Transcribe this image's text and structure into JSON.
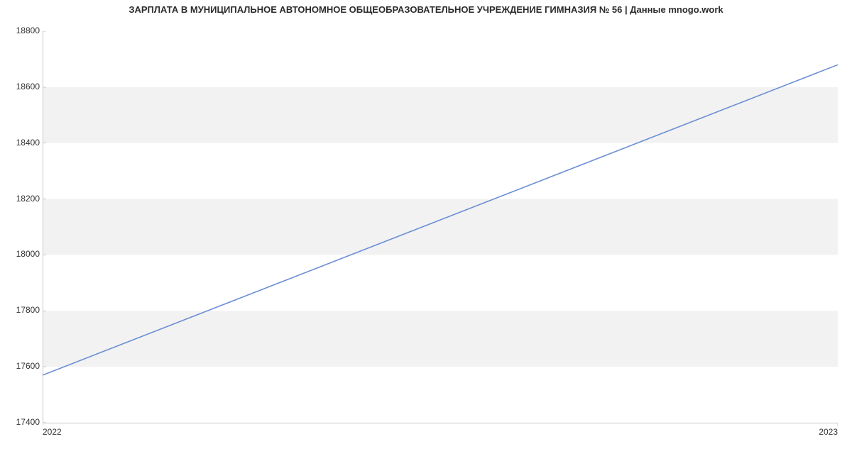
{
  "chart_data": {
    "type": "line",
    "title": "ЗАРПЛАТА В МУНИЦИПАЛЬНОЕ АВТОНОМНОЕ ОБЩЕОБРАЗОВАТЕЛЬНОЕ УЧРЕЖДЕНИЕ ГИМНАЗИЯ № 56 | Данные mnogo.work",
    "xlabel": "",
    "ylabel": "",
    "x": [
      2022,
      2023
    ],
    "values": [
      17570,
      18680
    ],
    "xlim": [
      2022,
      2023
    ],
    "ylim": [
      17400,
      18800
    ],
    "x_ticks": [
      "2022",
      "2023"
    ],
    "y_ticks": [
      "17400",
      "17600",
      "17800",
      "18000",
      "18200",
      "18400",
      "18600",
      "18800"
    ],
    "grid_bands": true,
    "line_color": "#6d8fd6"
  }
}
